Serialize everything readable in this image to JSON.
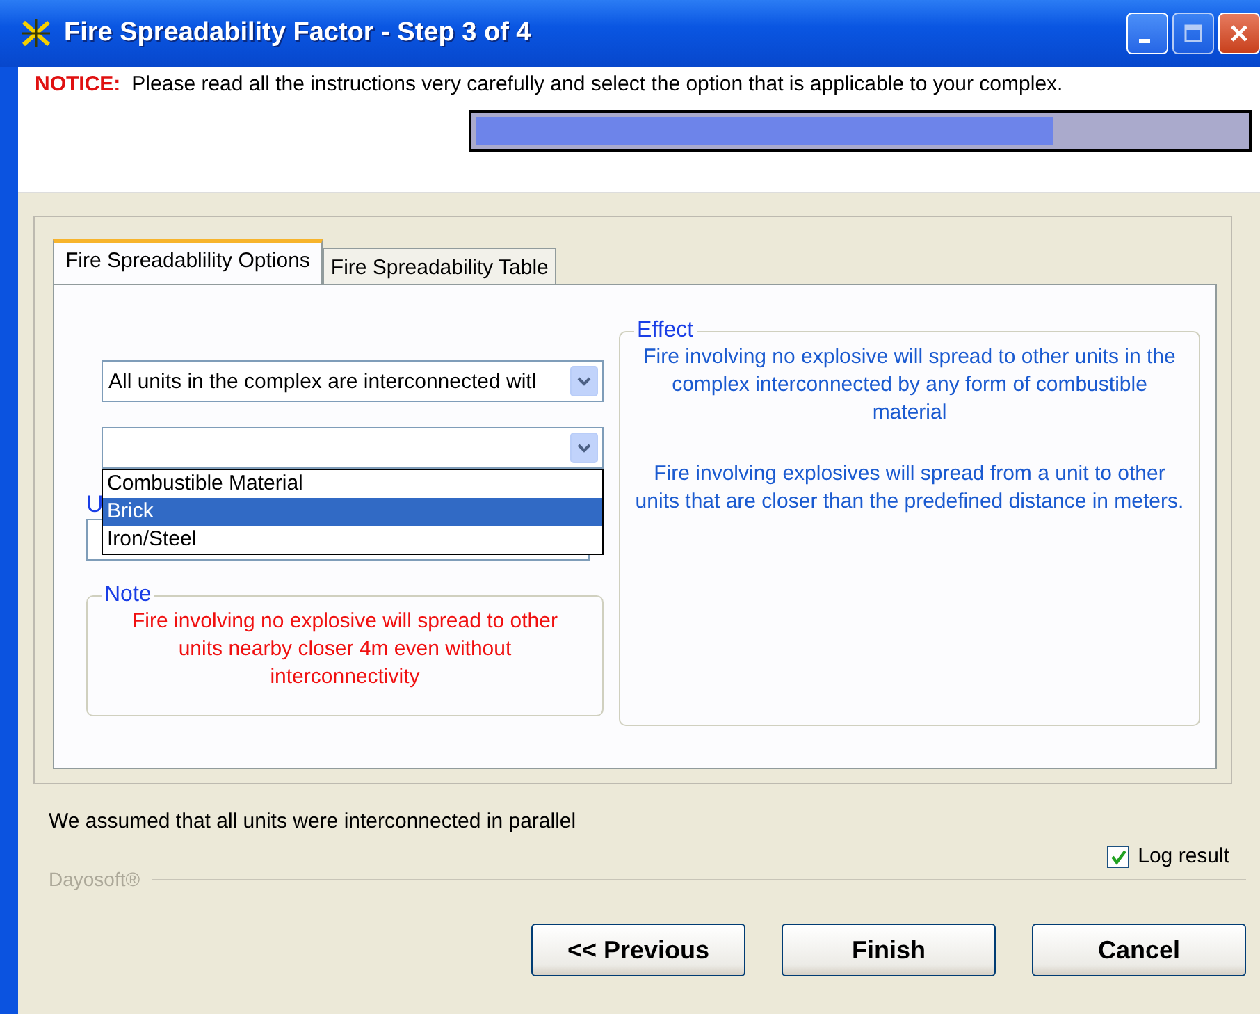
{
  "window": {
    "title": "Fire Spreadability Factor - Step 3 of 4"
  },
  "notice": {
    "label": "NOTICE:",
    "text": "Please read all the instructions very carefully and select the option that is applicable to your complex."
  },
  "progress": {
    "level": 0.75
  },
  "tabs": [
    {
      "label": "Fire Spreadablility Options",
      "selected": true
    },
    {
      "label": "Fire Spreadability Table",
      "selected": false
    }
  ],
  "options": {
    "combo_1": {
      "value": "All units in the complex are interconnected witl"
    },
    "combo_2": {
      "expanded": true,
      "items": [
        {
          "label": "Combustible Material",
          "selected": false
        },
        {
          "label": "Brick",
          "selected": true
        },
        {
          "label": "Iron/Steel",
          "selected": false
        }
      ]
    },
    "field_label": "U"
  },
  "note": {
    "title": "Note",
    "text": "Fire involving no explosive will spread to other units nearby closer 4m even without interconnectivity"
  },
  "effect": {
    "title": "Effect",
    "paragraphs": [
      "Fire involving no explosive will spread to other units in the complex interconnected by any form of combustible material",
      "Fire involving explosives will spread from a unit to other units that are closer than the predefined distance in meters."
    ]
  },
  "assumption": "We assumed that all units were interconnected in parallel",
  "log_result": {
    "label": "Log result",
    "checked": true
  },
  "brand": "Dayosoft®",
  "buttons": [
    "<< Previous",
    "Finish",
    "Cancel"
  ]
}
